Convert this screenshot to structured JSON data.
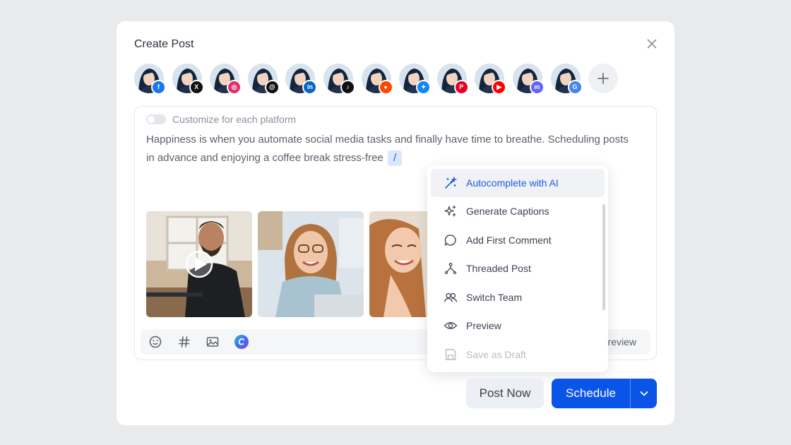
{
  "modal": {
    "title": "Create Post"
  },
  "accounts": [
    {
      "platform": "facebook",
      "badge_icon": "facebook-icon",
      "badge_color": "#1877f2",
      "glyph": "f"
    },
    {
      "platform": "x",
      "badge_icon": "x-icon",
      "badge_color": "#111111",
      "glyph": "X"
    },
    {
      "platform": "instagram",
      "badge_icon": "instagram-icon",
      "badge_color": "#e1306c",
      "glyph": "◎"
    },
    {
      "platform": "threads",
      "badge_icon": "threads-icon",
      "badge_color": "#111111",
      "glyph": "@"
    },
    {
      "platform": "linkedin",
      "badge_icon": "linkedin-icon",
      "badge_color": "#0a66c2",
      "glyph": "in"
    },
    {
      "platform": "tiktok",
      "badge_icon": "tiktok-icon",
      "badge_color": "#111111",
      "glyph": "♪"
    },
    {
      "platform": "reddit",
      "badge_icon": "reddit-icon",
      "badge_color": "#ff4500",
      "glyph": "●"
    },
    {
      "platform": "bluesky",
      "badge_icon": "bluesky-icon",
      "badge_color": "#1185fe",
      "glyph": "✦"
    },
    {
      "platform": "pinterest",
      "badge_icon": "pinterest-icon",
      "badge_color": "#e60023",
      "glyph": "P"
    },
    {
      "platform": "youtube",
      "badge_icon": "youtube-icon",
      "badge_color": "#ff0000",
      "glyph": "▶"
    },
    {
      "platform": "mastodon",
      "badge_icon": "mastodon-icon",
      "badge_color": "#6364ff",
      "glyph": "m"
    },
    {
      "platform": "google-business",
      "badge_icon": "google-business-icon",
      "badge_color": "#4285f4",
      "glyph": "G"
    }
  ],
  "editor": {
    "customize_label": "Customize for each platform",
    "text": "Happiness is when you automate social media tasks and finally have time to breathe. Scheduling posts in advance and enjoying a coffee break stress-free",
    "slash": "/"
  },
  "toolbar": {
    "preview_partial": "review"
  },
  "menu": {
    "items": [
      {
        "label": "Autocomplete with AI",
        "icon": "magic-wand-icon"
      },
      {
        "label": "Generate Captions",
        "icon": "sparkles-icon"
      },
      {
        "label": "Add First Comment",
        "icon": "comment-icon"
      },
      {
        "label": "Threaded Post",
        "icon": "thread-icon"
      },
      {
        "label": "Switch Team",
        "icon": "team-icon"
      },
      {
        "label": "Preview",
        "icon": "eye-icon"
      },
      {
        "label": "Save as Draft",
        "icon": "save-icon"
      }
    ]
  },
  "actions": {
    "post_now": "Post Now",
    "schedule": "Schedule"
  },
  "colors": {
    "accent": "#0a55e8",
    "slash_bg": "#dbe7fd"
  }
}
